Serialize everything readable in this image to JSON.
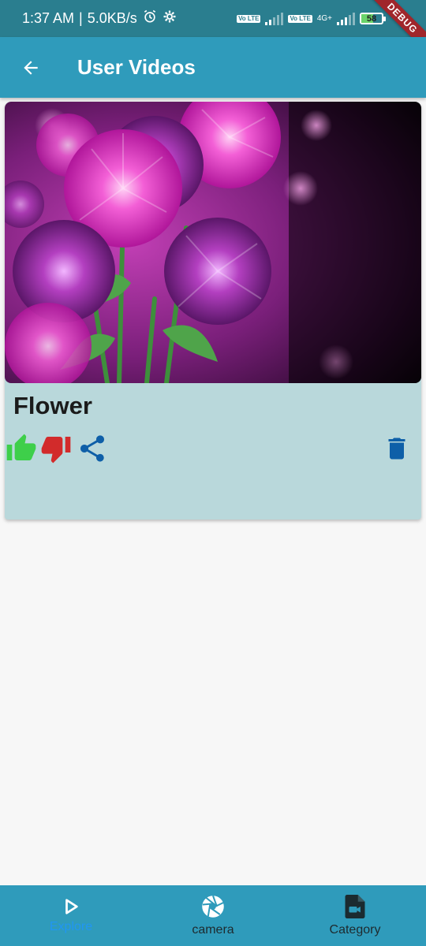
{
  "status_bar": {
    "time": "1:37 AM",
    "separator": "|",
    "speed": "5.0KB/s",
    "volte_label": "Vo LTE",
    "network_type": "4G+",
    "battery": "58",
    "debug_banner": "DEBUG"
  },
  "app_bar": {
    "title": "User Videos"
  },
  "video_card": {
    "title": "Flower",
    "colors": {
      "like": "#3ecf4a",
      "dislike": "#d22b2b",
      "share": "#0e5fa8",
      "delete": "#0e5fa8"
    }
  },
  "bottom_nav": {
    "items": [
      {
        "label": "Explore",
        "icon": "play-icon",
        "active": true
      },
      {
        "label": "camera",
        "icon": "camera-aperture-icon",
        "active": false
      },
      {
        "label": "Category",
        "icon": "video-file-icon",
        "active": false
      }
    ]
  },
  "colors": {
    "status_bar": "#2a7e8f",
    "app_bar": "#2f9bbb",
    "card": "#b9d8db",
    "active_nav": "#2196f3"
  }
}
